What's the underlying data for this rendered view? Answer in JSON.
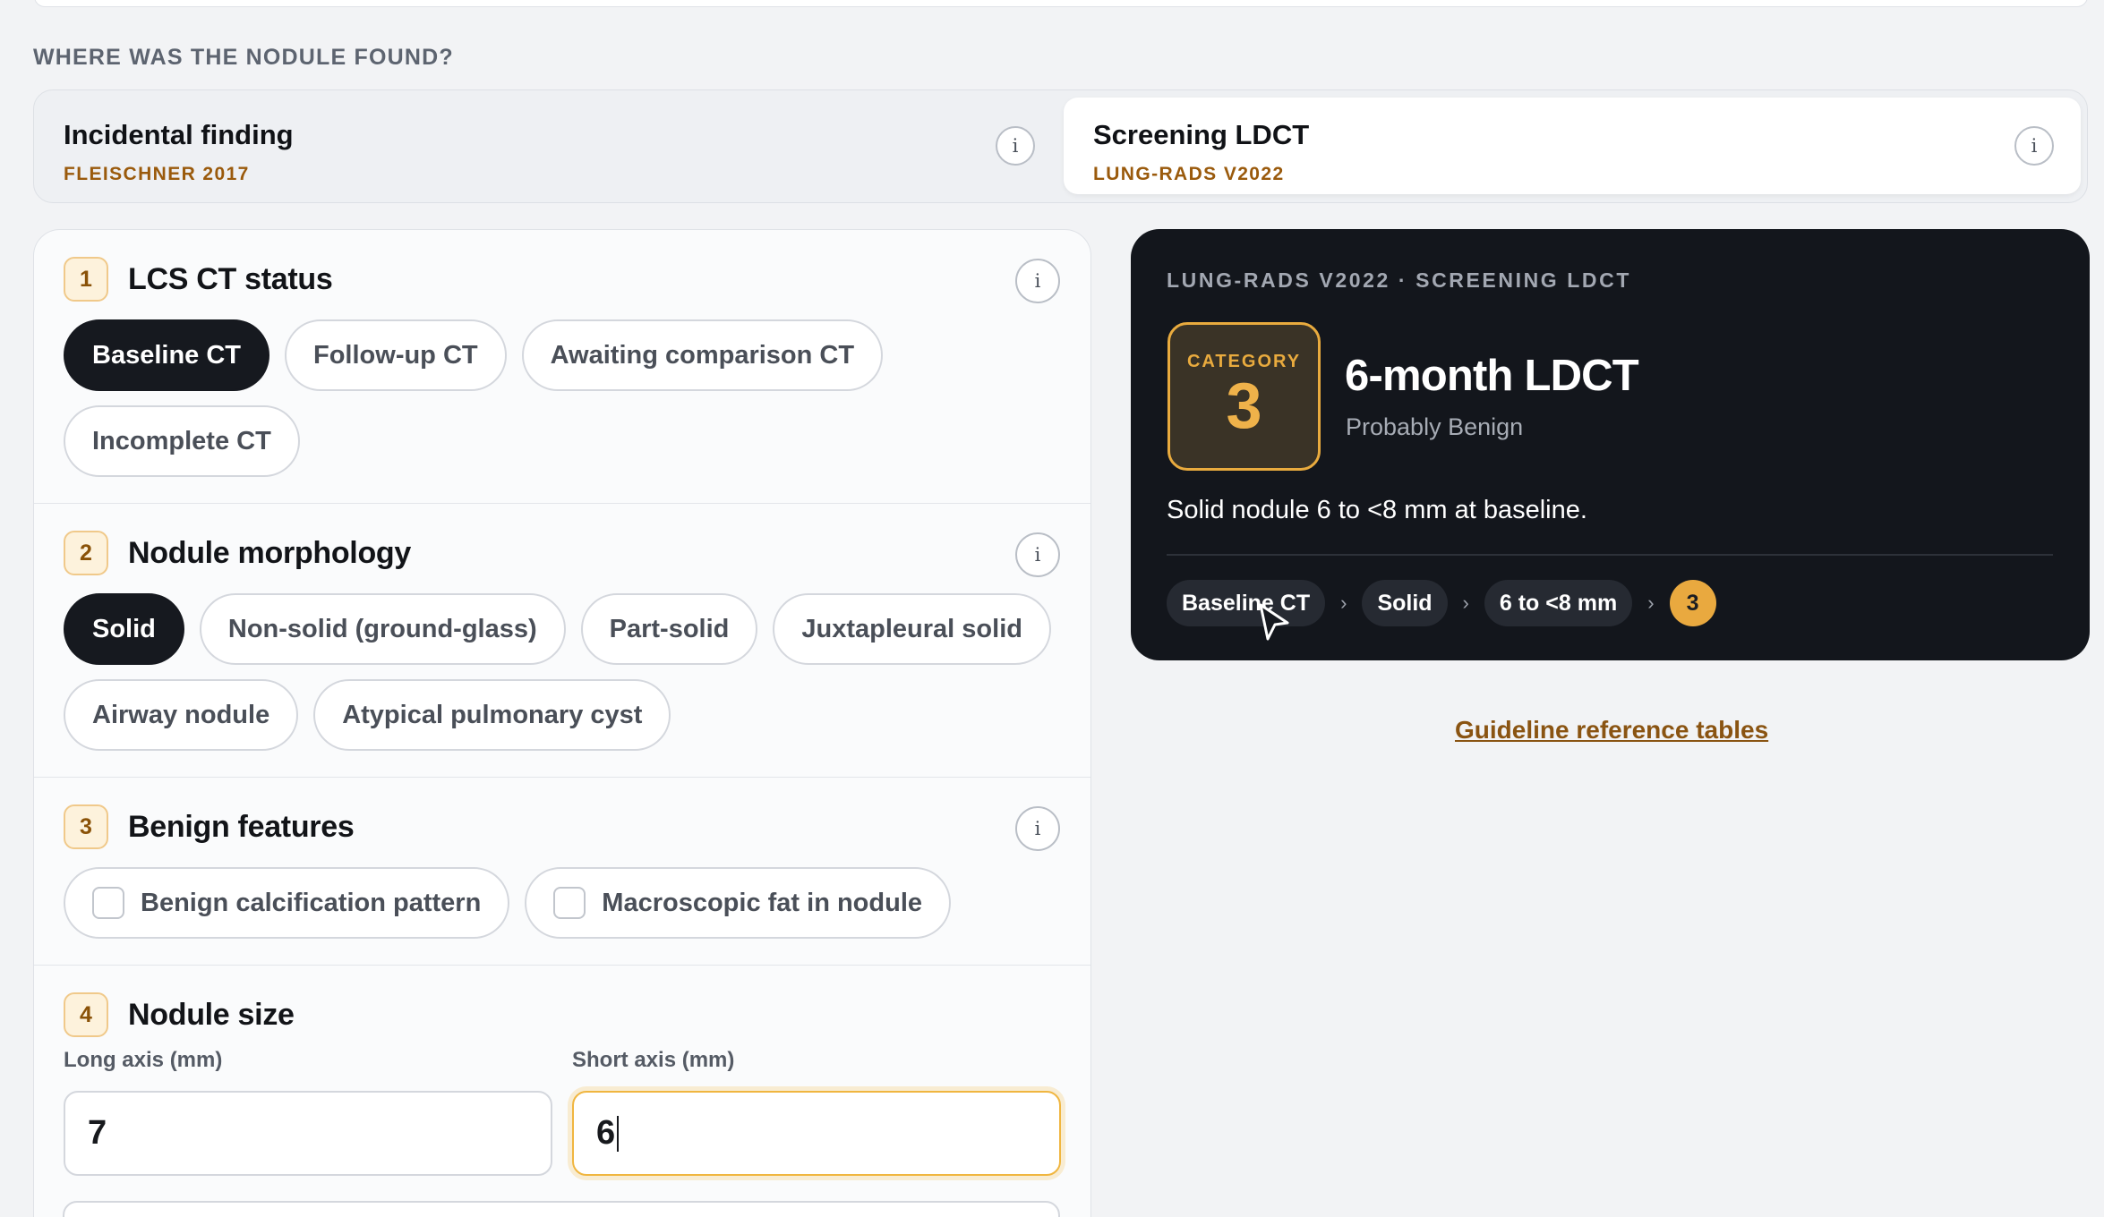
{
  "origin": {
    "question": "WHERE WAS THE NODULE FOUND?",
    "options": [
      {
        "title": "Incidental finding",
        "subtitle": "FLEISCHNER 2017",
        "selected": false
      },
      {
        "title": "Screening LDCT",
        "subtitle": "LUNG-RADS V2022",
        "selected": true
      }
    ]
  },
  "steps": [
    {
      "number": "1",
      "title": "LCS CT status",
      "chips": [
        "Baseline CT",
        "Follow-up CT",
        "Awaiting comparison CT",
        "Incomplete CT"
      ],
      "selected": "Baseline CT"
    },
    {
      "number": "2",
      "title": "Nodule morphology",
      "chips": [
        "Solid",
        "Non-solid (ground-glass)",
        "Part-solid",
        "Juxtapleural solid",
        "Airway nodule",
        "Atypical pulmonary cyst"
      ],
      "selected": "Solid"
    },
    {
      "number": "3",
      "title": "Benign features",
      "checkboxes": [
        "Benign calcification pattern",
        "Macroscopic fat in nodule"
      ]
    },
    {
      "number": "4",
      "title": "Nodule size",
      "fields": [
        {
          "label": "Long axis (mm)",
          "value": "7"
        },
        {
          "label": "Short axis (mm)",
          "value": "6"
        }
      ]
    }
  ],
  "info_glyph": "i",
  "result": {
    "eyebrow": "LUNG-RADS V2022 · SCREENING LDCT",
    "category_label": "CATEGORY",
    "category_value": "3",
    "title": "6-month LDCT",
    "subtitle": "Probably Benign",
    "description": "Solid nodule 6 to <8 mm at baseline.",
    "breadcrumbs": [
      "Baseline CT",
      "Solid",
      "6 to <8 mm"
    ],
    "badge": "3",
    "accent_color": "#e9ab3e"
  },
  "reference_link": "Guideline reference tables"
}
